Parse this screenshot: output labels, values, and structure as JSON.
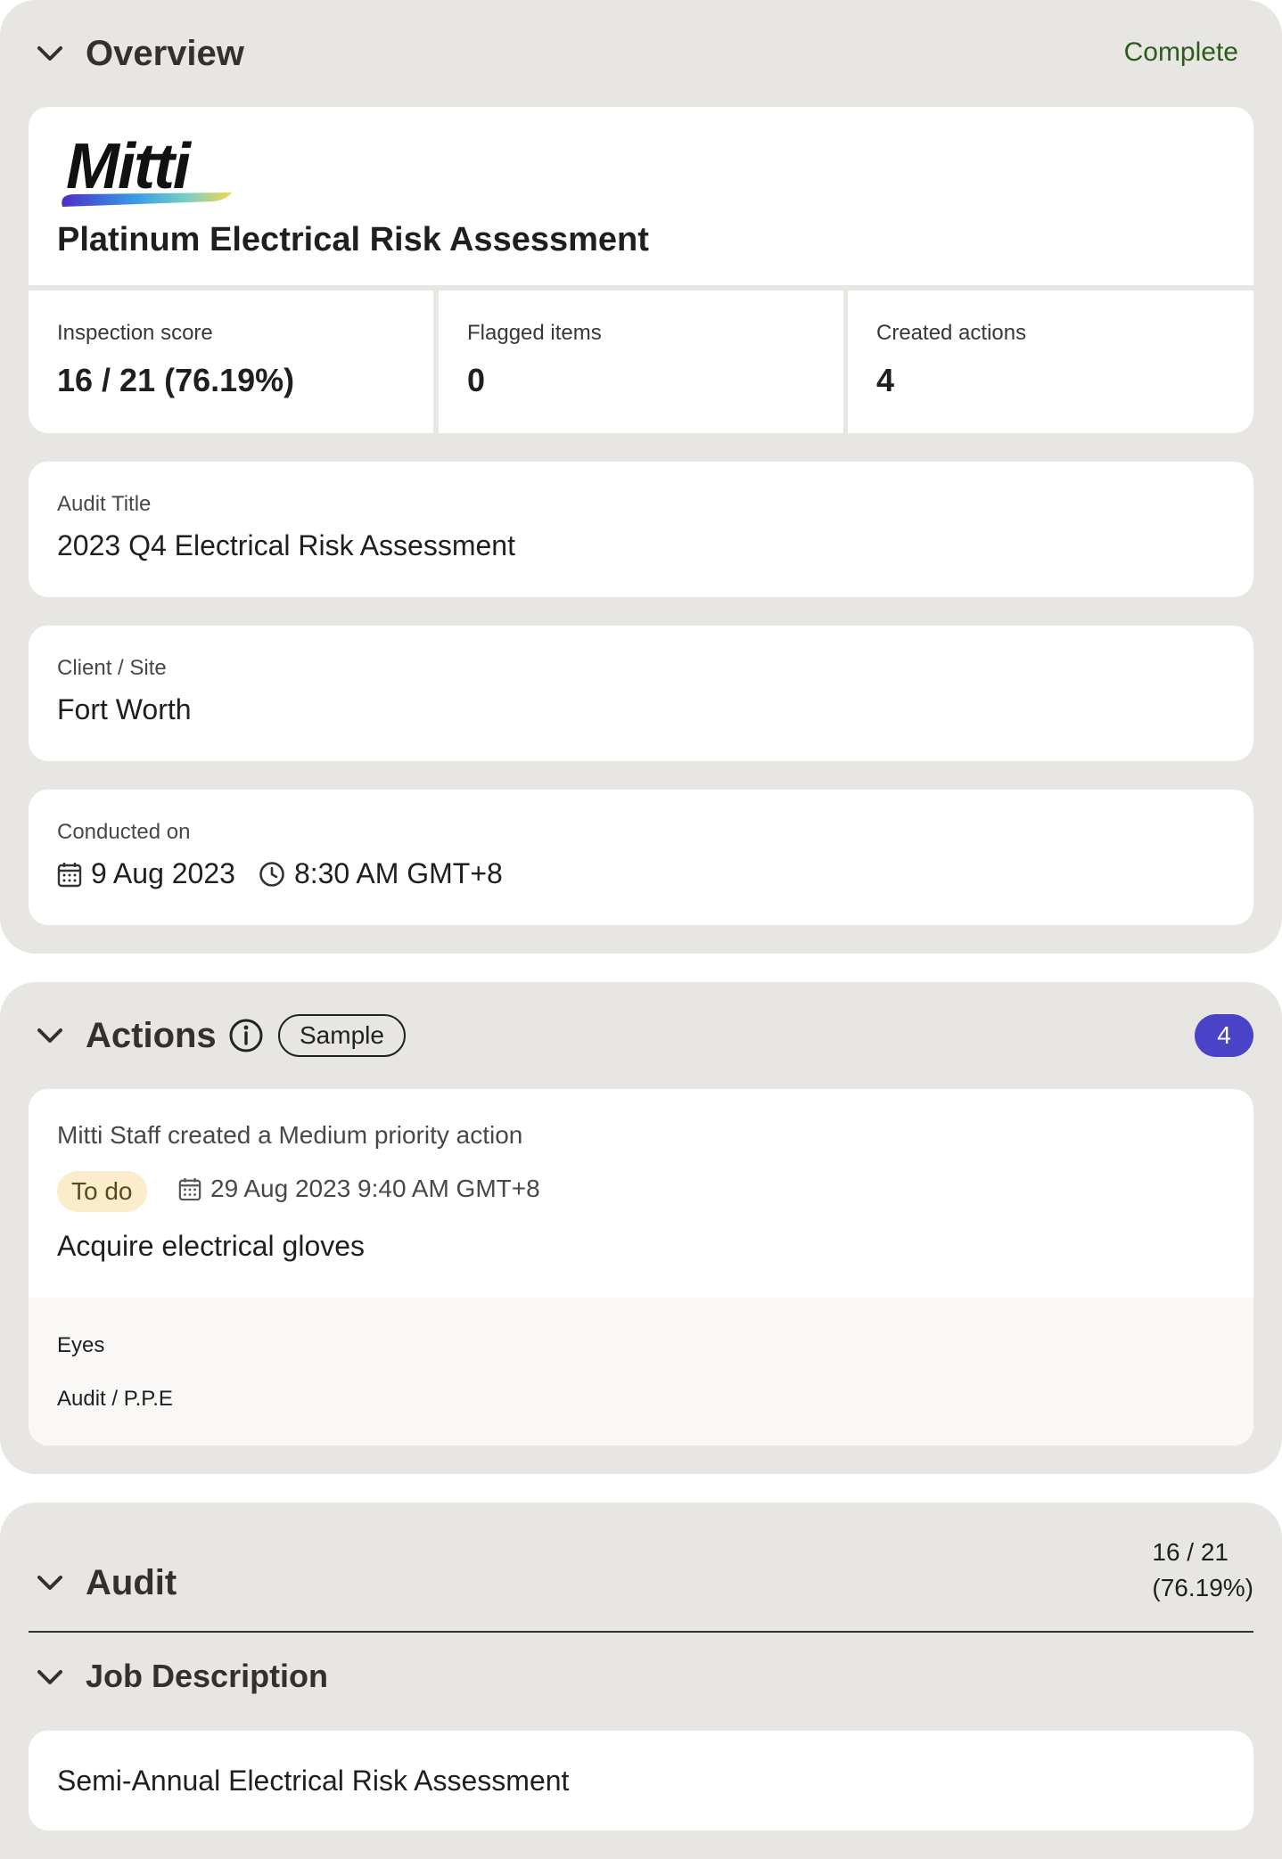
{
  "overview": {
    "title": "Overview",
    "status": "Complete",
    "logo_text": "Mitti",
    "template_title": "Platinum Electrical Risk Assessment",
    "stats": [
      {
        "label": "Inspection score",
        "value": "16 / 21 (76.19%)"
      },
      {
        "label": "Flagged items",
        "value": "0"
      },
      {
        "label": "Created actions",
        "value": "4"
      }
    ],
    "audit_title_label": "Audit Title",
    "audit_title_value": "2023 Q4 Electrical Risk Assessment",
    "client_label": "Client / Site",
    "client_value": "Fort Worth",
    "conducted_label": "Conducted on",
    "conducted_date": "9 Aug 2023",
    "conducted_time": "8:30 AM GMT+8"
  },
  "actions": {
    "title": "Actions",
    "tag": "Sample",
    "count": "4",
    "item": {
      "meta": "Mitti Staff created a Medium priority action",
      "status": "To do",
      "due": "29 Aug 2023 9:40 AM GMT+8",
      "title": "Acquire electrical gloves",
      "question": "Eyes",
      "path": "Audit / P.P.E"
    }
  },
  "audit": {
    "title": "Audit",
    "score_line1": "16 / 21",
    "score_line2": "(76.19%)",
    "subsection_title": "Job Description",
    "subsection_value": "Semi-Annual Electrical Risk Assessment"
  },
  "colors": {
    "section_bg": "#e8e6e2",
    "complete_text": "#2e5a1e",
    "count_badge": "#4a43c8",
    "todo_badge": "#fbeccb"
  }
}
